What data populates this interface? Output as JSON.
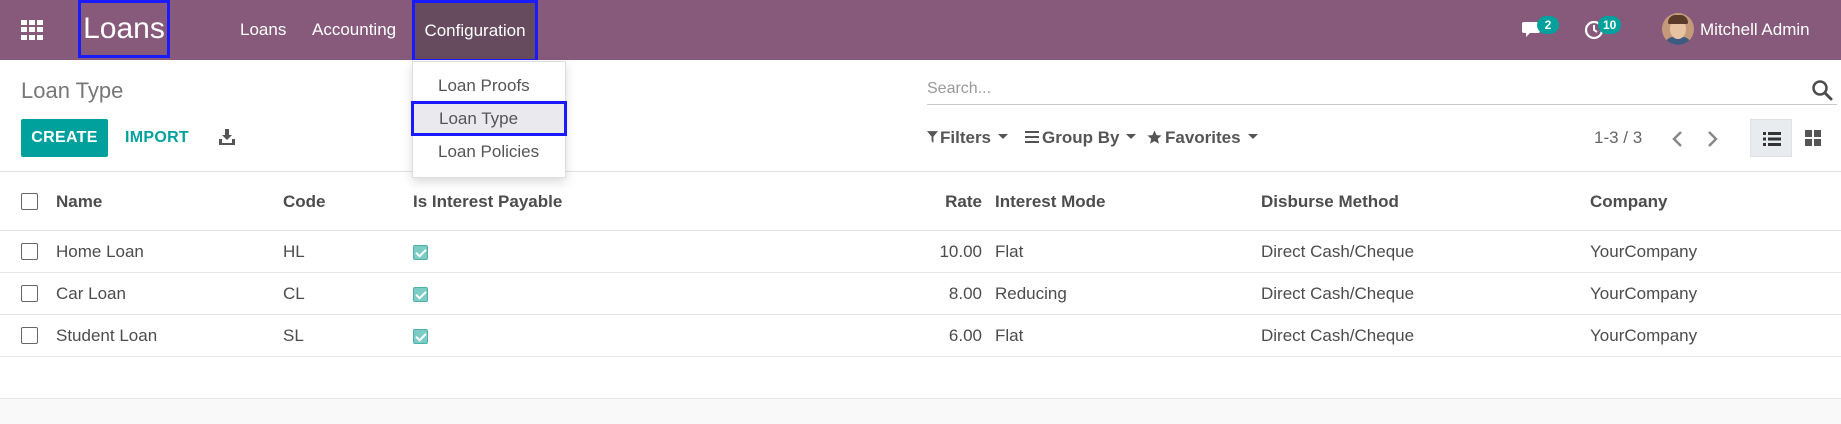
{
  "navbar": {
    "app_name": "Loans",
    "menu": [
      "Loans",
      "Accounting",
      "Configuration"
    ],
    "messages_count": "2",
    "activities_count": "10",
    "user_name": "Mitchell Admin"
  },
  "dropdown": {
    "items": [
      "Loan Proofs",
      "Loan Type",
      "Loan Policies"
    ],
    "highlighted": "Loan Type"
  },
  "control_panel": {
    "breadcrumb": "Loan Type",
    "create_label": "CREATE",
    "import_label": "IMPORT",
    "search_placeholder": "Search...",
    "filters_label": "Filters",
    "groupby_label": "Group By",
    "favorites_label": "Favorites",
    "pager": "1-3 / 3",
    "active_view": "list"
  },
  "table": {
    "columns": [
      "Name",
      "Code",
      "Is Interest Payable",
      "Rate",
      "Interest Mode",
      "Disburse Method",
      "Company"
    ],
    "rows": [
      {
        "name": "Home Loan",
        "code": "HL",
        "payable": true,
        "rate": "10.00",
        "mode": "Flat",
        "method": "Direct Cash/Cheque",
        "company": "YourCompany"
      },
      {
        "name": "Car Loan",
        "code": "CL",
        "payable": true,
        "rate": "8.00",
        "mode": "Reducing",
        "method": "Direct Cash/Cheque",
        "company": "YourCompany"
      },
      {
        "name": "Student Loan",
        "code": "SL",
        "payable": true,
        "rate": "6.00",
        "mode": "Flat",
        "method": "Direct Cash/Cheque",
        "company": "YourCompany"
      }
    ]
  },
  "colors": {
    "navbar": "#875a7b",
    "accent": "#00a09d",
    "highlight_border": "#1a1aff"
  }
}
